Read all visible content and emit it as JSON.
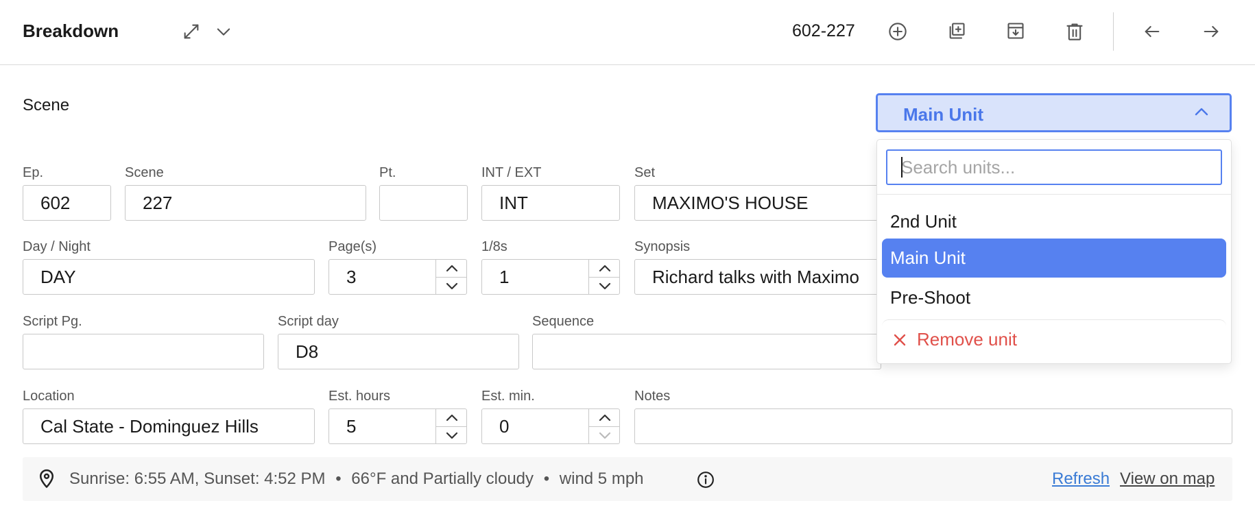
{
  "header": {
    "title": "Breakdown",
    "scene_code": "602-227",
    "icons": [
      "expand-icon",
      "chevron-down-icon",
      "plus-circle-icon",
      "duplicate-icon",
      "archive-icon",
      "trash-icon",
      "arrow-left-icon",
      "arrow-right-icon"
    ]
  },
  "section": {
    "title": "Scene"
  },
  "fields": {
    "ep": {
      "label": "Ep.",
      "value": "602"
    },
    "scene": {
      "label": "Scene",
      "value": "227"
    },
    "pt": {
      "label": "Pt.",
      "value": ""
    },
    "int_ext": {
      "label": "INT / EXT",
      "value": "INT"
    },
    "set": {
      "label": "Set",
      "value": "MAXIMO'S HOUSE"
    },
    "day_night": {
      "label": "Day / Night",
      "value": "DAY"
    },
    "pages": {
      "label": "Page(s)",
      "value": "3"
    },
    "eighths": {
      "label": "1/8s",
      "value": "1"
    },
    "synopsis": {
      "label": "Synopsis",
      "value": "Richard talks with Maximo"
    },
    "script_pg": {
      "label": "Script Pg.",
      "value": ""
    },
    "script_day": {
      "label": "Script day",
      "value": "D8"
    },
    "sequence": {
      "label": "Sequence",
      "value": ""
    },
    "location": {
      "label": "Location",
      "value": "Cal State - Dominguez Hills"
    },
    "est_hours": {
      "label": "Est. hours",
      "value": "5"
    },
    "est_min": {
      "label": "Est. min.",
      "value": "0"
    },
    "notes": {
      "label": "Notes",
      "value": ""
    }
  },
  "info_bar": {
    "sun": "Sunrise: 6:55 AM, Sunset: 4:52 PM",
    "weather": "66°F and Partially cloudy",
    "wind": "wind 5 mph",
    "separator": "•",
    "refresh_label": "Refresh",
    "map_label": "View on map",
    "colors": {
      "refresh": "#3a7bd5",
      "map": "#444444"
    }
  },
  "unit_select": {
    "selected": "Main Unit",
    "search_placeholder": "Search units...",
    "options": [
      "2nd Unit",
      "Main Unit",
      "Pre-Shoot"
    ],
    "remove_label": "Remove unit",
    "colors": {
      "accent": "#5681f0",
      "selected_bg": "#d9e3fb",
      "remove": "#e0504a"
    }
  }
}
